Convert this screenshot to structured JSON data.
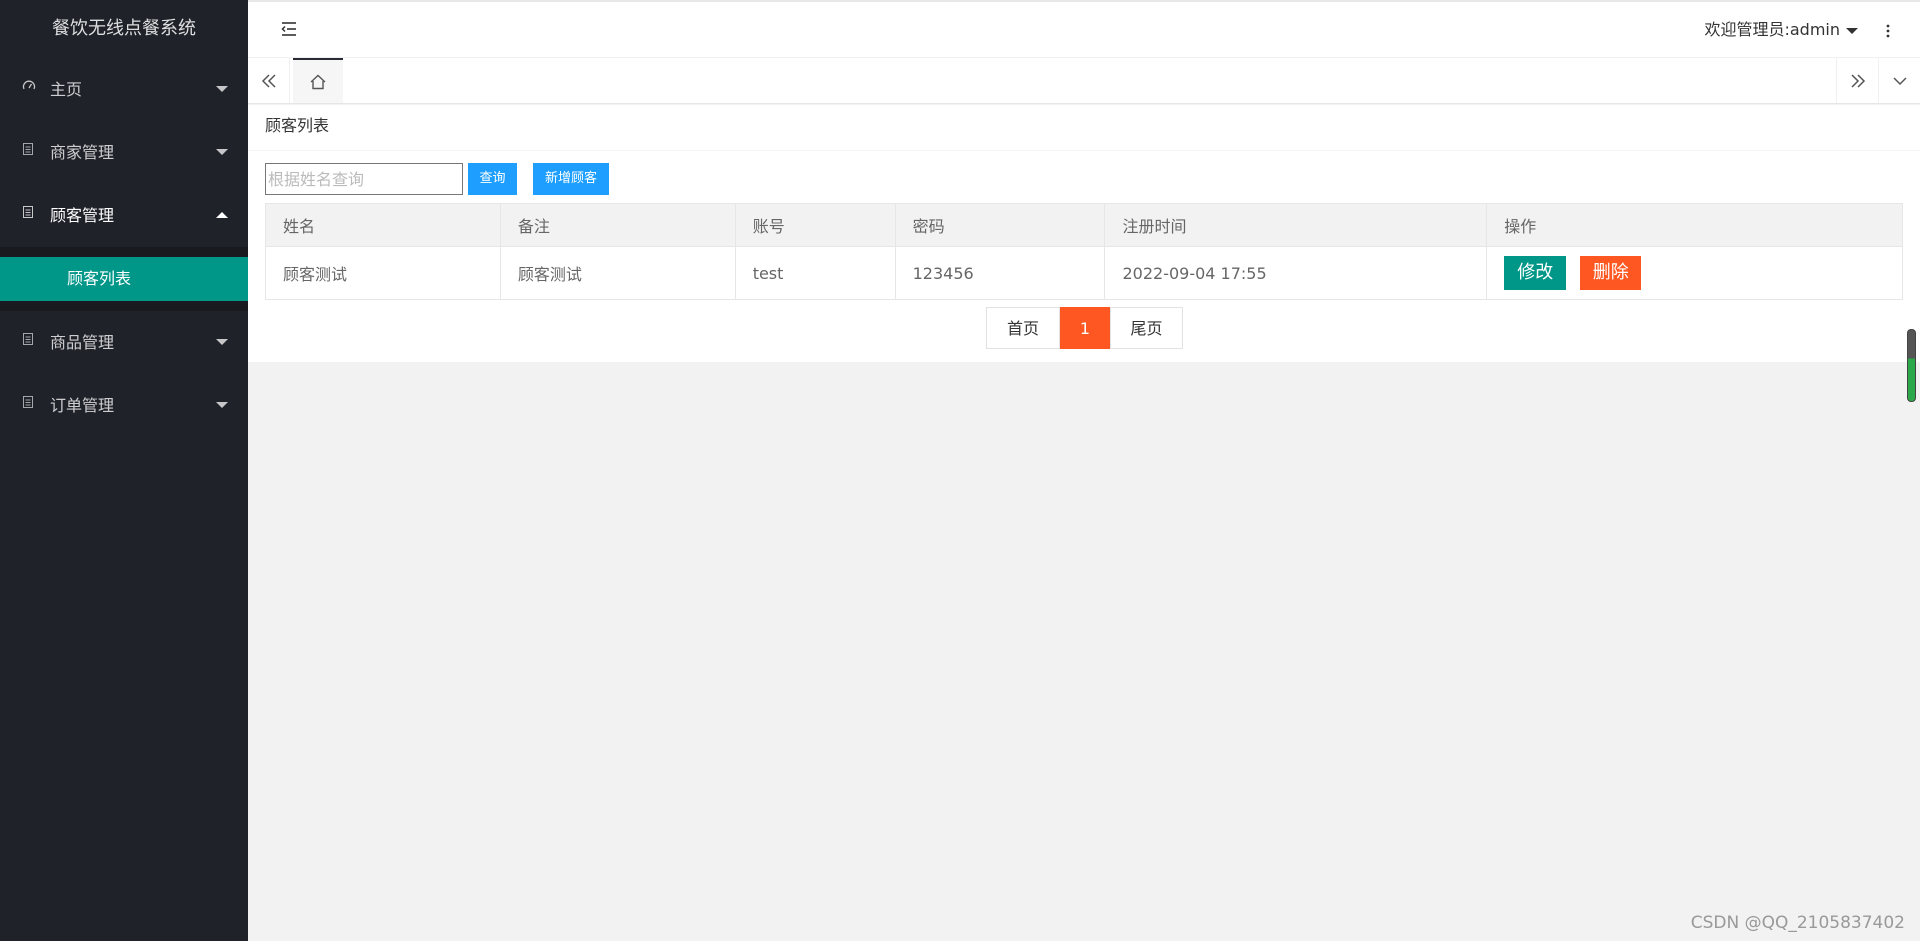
{
  "app": {
    "title": "餐饮无线点餐系统"
  },
  "sidebar": {
    "items": [
      {
        "label": "主页",
        "icon": "dashboard-icon"
      },
      {
        "label": "商家管理",
        "icon": "file-icon"
      },
      {
        "label": "顾客管理",
        "icon": "file-icon",
        "expanded": true,
        "children": [
          {
            "label": "顾客列表",
            "active": true
          }
        ]
      },
      {
        "label": "商品管理",
        "icon": "file-icon"
      },
      {
        "label": "订单管理",
        "icon": "file-icon"
      }
    ]
  },
  "header": {
    "user_label": "欢迎管理员:admin"
  },
  "tabs": {
    "home_icon": "home-icon"
  },
  "card": {
    "title": "顾客列表"
  },
  "toolbar": {
    "search_placeholder": "根据姓名查询",
    "search_value": "",
    "query_label": "查询",
    "add_label": "新增顾客"
  },
  "table": {
    "columns": [
      "姓名",
      "备注",
      "账号",
      "密码",
      "注册时间",
      "操作"
    ],
    "rows": [
      {
        "name": "顾客测试",
        "remark": "顾客测试",
        "account": "test",
        "password": "123456",
        "registered": "2022-09-04 17:55",
        "edit_label": "修改",
        "delete_label": "删除"
      }
    ]
  },
  "pager": {
    "first_label": "首页",
    "current": "1",
    "last_label": "尾页"
  },
  "watermark": "CSDN @QQ_2105837402",
  "colors": {
    "sidebar_bg": "#20222a",
    "active_teal": "#009688",
    "primary_blue": "#1e9fff",
    "danger_orange": "#ff5722"
  }
}
